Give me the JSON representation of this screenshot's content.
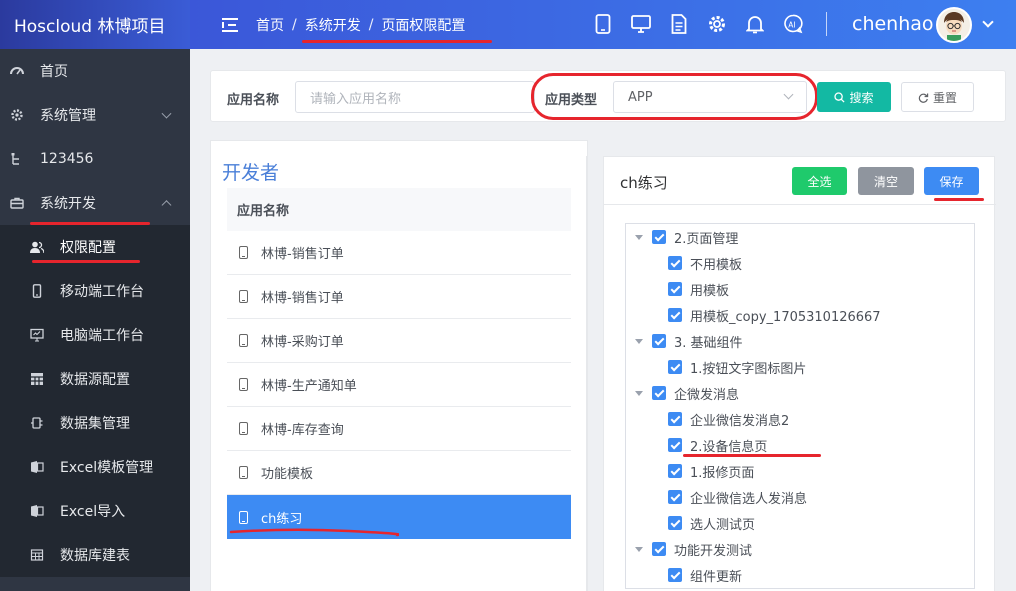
{
  "brand": "Hoscloud 林博项目",
  "sidebar": {
    "items": [
      {
        "label": "首页",
        "icon": "dashboard-icon"
      },
      {
        "label": "系统管理",
        "icon": "gear-icon"
      },
      {
        "label": "123456",
        "icon": "tree-icon"
      },
      {
        "label": "系统开发",
        "icon": "briefcase-icon"
      }
    ],
    "submenu": [
      {
        "label": "权限配置",
        "icon": "user-group-icon"
      },
      {
        "label": "移动端工作台",
        "icon": "mobile-icon"
      },
      {
        "label": "电脑端工作台",
        "icon": "monitor-icon"
      },
      {
        "label": "数据源配置",
        "icon": "grid-icon"
      },
      {
        "label": "数据集管理",
        "icon": "dataset-icon"
      },
      {
        "label": "Excel模板管理",
        "icon": "excel-icon"
      },
      {
        "label": "Excel导入",
        "icon": "import-icon"
      },
      {
        "label": "数据库建表",
        "icon": "table-icon"
      }
    ]
  },
  "header": {
    "breadcrumbs": [
      "首页",
      "系统开发",
      "页面权限配置"
    ],
    "separator": "/",
    "username": "chenhao",
    "icons": [
      "tablet-icon",
      "monitor-icon",
      "document-icon",
      "settings-icon",
      "bell-icon",
      "ai-icon"
    ]
  },
  "search": {
    "app_name_label": "应用名称",
    "app_name_placeholder": "请输入应用名称",
    "app_type_label": "应用类型",
    "app_type_value": "APP",
    "search_button": "搜索",
    "reset_button": "重置"
  },
  "developer_panel": {
    "title": "开发者",
    "column_header": "应用名称",
    "rows": [
      "林博-销售订单",
      "林博-销售订单",
      "林博-采购订单",
      "林博-生产通知单",
      "林博-库存查询",
      "功能模板",
      "ch练习"
    ],
    "selected": "ch练习"
  },
  "permission_panel": {
    "title": "ch练习",
    "select_all": "全选",
    "clear": "清空",
    "save": "保存",
    "tree": [
      {
        "label": "2.页面管理",
        "level": 0,
        "checked": true
      },
      {
        "label": "不用模板",
        "level": 1,
        "checked": true
      },
      {
        "label": "用模板",
        "level": 1,
        "checked": true
      },
      {
        "label": "用模板_copy_1705310126667",
        "level": 1,
        "checked": true
      },
      {
        "label": "3. 基础组件",
        "level": 0,
        "checked": true
      },
      {
        "label": "1.按钮文字图标图片",
        "level": 1,
        "checked": true
      },
      {
        "label": "企微发消息",
        "level": 0,
        "checked": true
      },
      {
        "label": "企业微信发消息2",
        "level": 1,
        "checked": true
      },
      {
        "label": "2.设备信息页",
        "level": 1,
        "checked": true
      },
      {
        "label": "1.报修页面",
        "level": 1,
        "checked": true
      },
      {
        "label": "企业微信选人发消息",
        "level": 1,
        "checked": true
      },
      {
        "label": "选人测试页",
        "level": 1,
        "checked": true
      },
      {
        "label": "功能开发测试",
        "level": 0,
        "checked": true
      },
      {
        "label": "组件更新",
        "level": 1,
        "checked": true
      }
    ]
  },
  "colors": {
    "sidebar_bg": "#2f3643",
    "header_gradient_start": "#3b57d8",
    "accent_blue": "#3d8bf3",
    "teal": "#13b9a3",
    "green": "#1fca6c",
    "gray": "#8f959e",
    "annotation_red": "#e6252d"
  }
}
